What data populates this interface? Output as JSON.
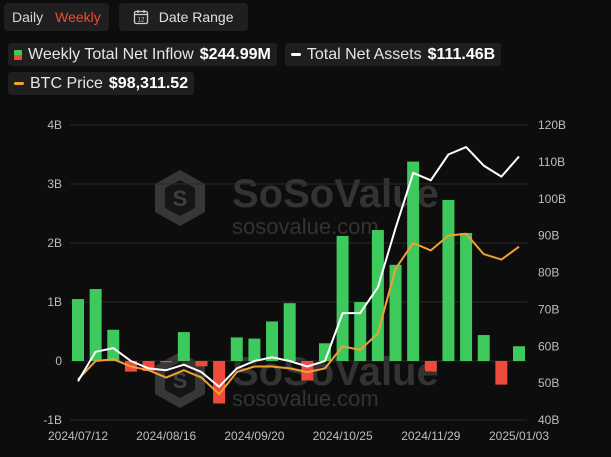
{
  "colors": {
    "inflow_positive": "#3ec95c",
    "inflow_negative": "#ef4b3d",
    "net_assets_line": "#ffffff",
    "btc_line": "#f0a030",
    "active_tab": "#f04b3a"
  },
  "toolbar": {
    "period_options": [
      "Daily",
      "Weekly"
    ],
    "active_period": "Weekly",
    "date_range_label": "Date Range",
    "calendar_icon": "calendar-icon",
    "calendar_day": "12"
  },
  "legend": {
    "inflow_label": "Weekly Total Net Inflow",
    "inflow_value": "$244.99M",
    "assets_label": "Total Net Assets",
    "assets_value": "$111.46B",
    "btc_label": "BTC Price",
    "btc_value": "$98,311.52"
  },
  "watermark": {
    "brand": "SoSoValue",
    "url": "sosovalue.com"
  },
  "chart_data": {
    "type": "bar",
    "x_tick_labels": [
      "2024/07/12",
      "2024/08/16",
      "2024/09/20",
      "2024/10/25",
      "2024/11/29",
      "2025/01/03"
    ],
    "left_axis": {
      "ticks": [
        "4B",
        "3B",
        "2B",
        "1B",
        "0",
        "-1B"
      ],
      "ylim": [
        -1,
        4
      ]
    },
    "right_axis": {
      "ticks": [
        "120B",
        "110B",
        "100B",
        "90B",
        "80B",
        "70B",
        "60B",
        "50B",
        "40B"
      ],
      "ylim": [
        40,
        120
      ]
    },
    "series": [
      {
        "name": "Weekly Total Net Inflow",
        "unit": "B",
        "axis": "left",
        "values": [
          1.05,
          1.22,
          0.53,
          -0.18,
          -0.17,
          -0.02,
          0.49,
          -0.09,
          -0.72,
          0.4,
          0.38,
          0.67,
          0.98,
          -0.33,
          0.3,
          2.12,
          1.0,
          2.22,
          1.63,
          3.38,
          -0.18,
          2.73,
          2.17,
          0.44,
          -0.4,
          0.25
        ]
      },
      {
        "name": "Total Net Assets",
        "unit": "B",
        "axis": "right",
        "values": [
          50.5,
          58.5,
          59.5,
          56.0,
          54.0,
          53.5,
          55.0,
          53.0,
          49.0,
          54.0,
          56.0,
          57.0,
          56.0,
          54.5,
          56.0,
          69.0,
          69.0,
          76.0,
          92.0,
          107.0,
          105.0,
          112.0,
          114.0,
          109.0,
          106.0,
          111.46
        ]
      },
      {
        "name": "BTC Price",
        "unit": "B",
        "axis": "right",
        "values": [
          51.0,
          56.0,
          56.5,
          54.5,
          53.5,
          51.5,
          53.5,
          51.5,
          47.0,
          53.0,
          54.5,
          54.5,
          54.0,
          53.0,
          54.0,
          60.0,
          59.0,
          63.5,
          81.0,
          88.0,
          86.0,
          90.0,
          90.5,
          85.0,
          83.5,
          87.0
        ]
      }
    ]
  }
}
